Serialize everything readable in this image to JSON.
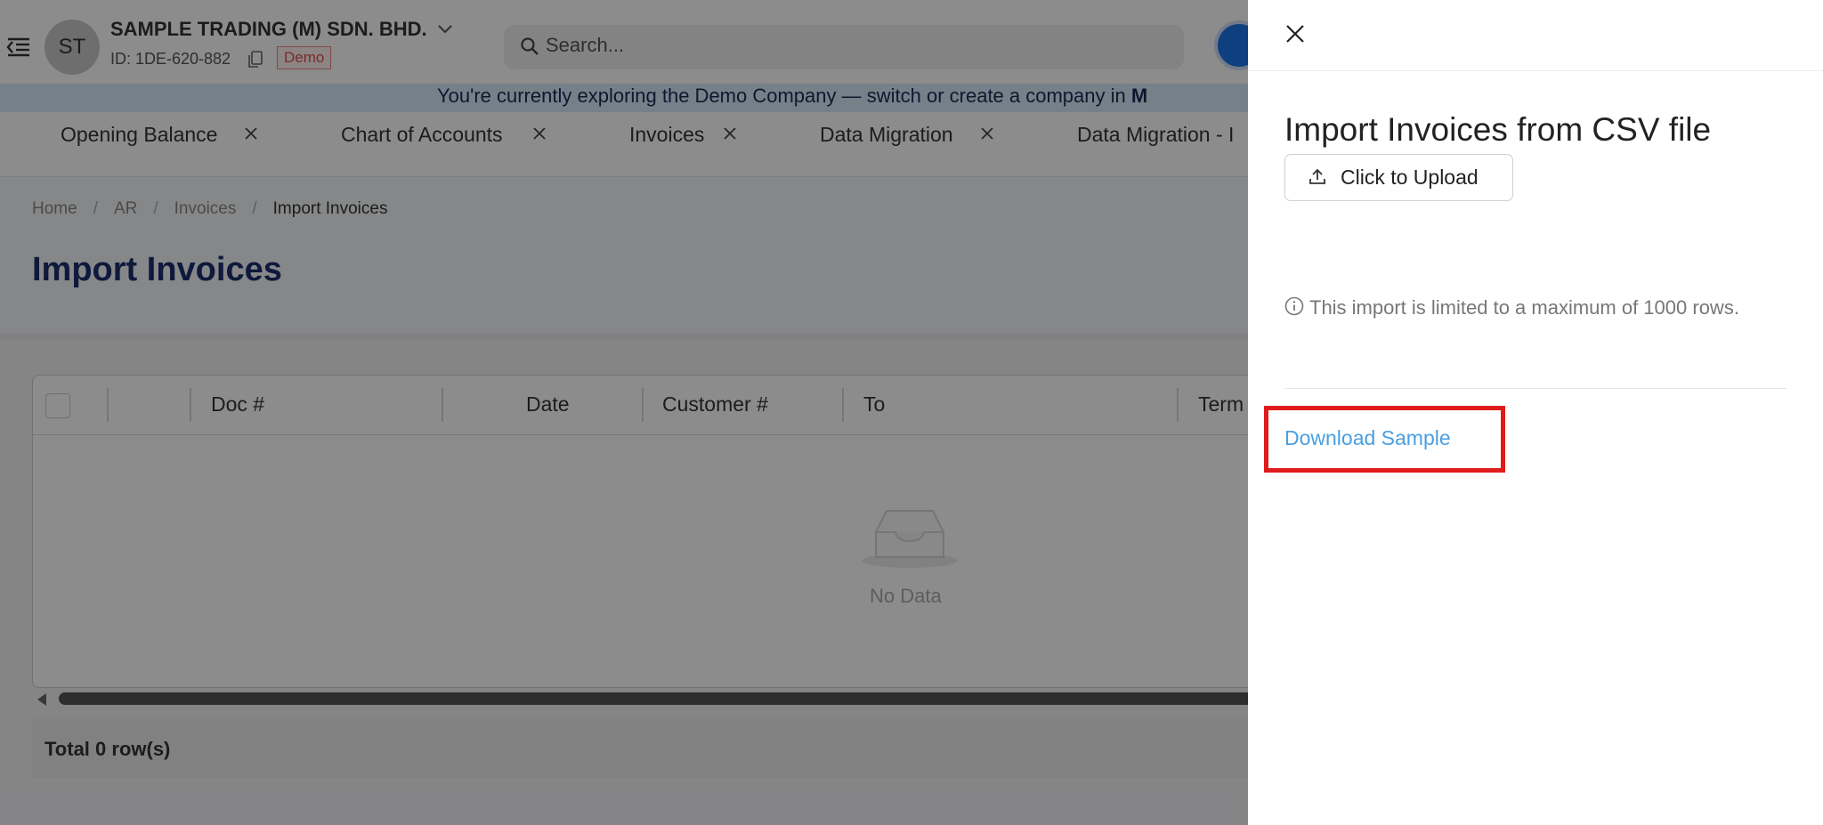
{
  "header": {
    "avatar_initials": "ST",
    "company_name": "SAMPLE TRADING (M) SDN. BHD.",
    "company_id": "ID: 1DE-620-882",
    "demo_badge": "Demo",
    "search_placeholder": "Search..."
  },
  "banner": {
    "text": "You're currently exploring the Demo Company — switch or create a company in ",
    "bold_tail": "M"
  },
  "tabs": [
    {
      "label": "Opening Balance"
    },
    {
      "label": "Chart of Accounts"
    },
    {
      "label": "Invoices"
    },
    {
      "label": "Data Migration"
    },
    {
      "label": "Data Migration - I"
    }
  ],
  "breadcrumb": {
    "home": "Home",
    "ar": "AR",
    "invoices": "Invoices",
    "current": "Import Invoices"
  },
  "page": {
    "title": "Import Invoices"
  },
  "table": {
    "columns": [
      "Doc #",
      "Date",
      "Customer #",
      "To",
      "Term"
    ],
    "empty_text": "No Data",
    "total": "Total 0 row(s)"
  },
  "drawer": {
    "title": "Import Invoices from CSV file",
    "upload_label": "Click to Upload",
    "info_text": "This import is limited to a maximum of 1000 rows.",
    "download_label": "Download Sample"
  },
  "colors": {
    "highlight": "#e01b1b",
    "link": "#4a9fe0",
    "title": "#1a2e6e",
    "banner_bg": "#d8eaf8"
  }
}
